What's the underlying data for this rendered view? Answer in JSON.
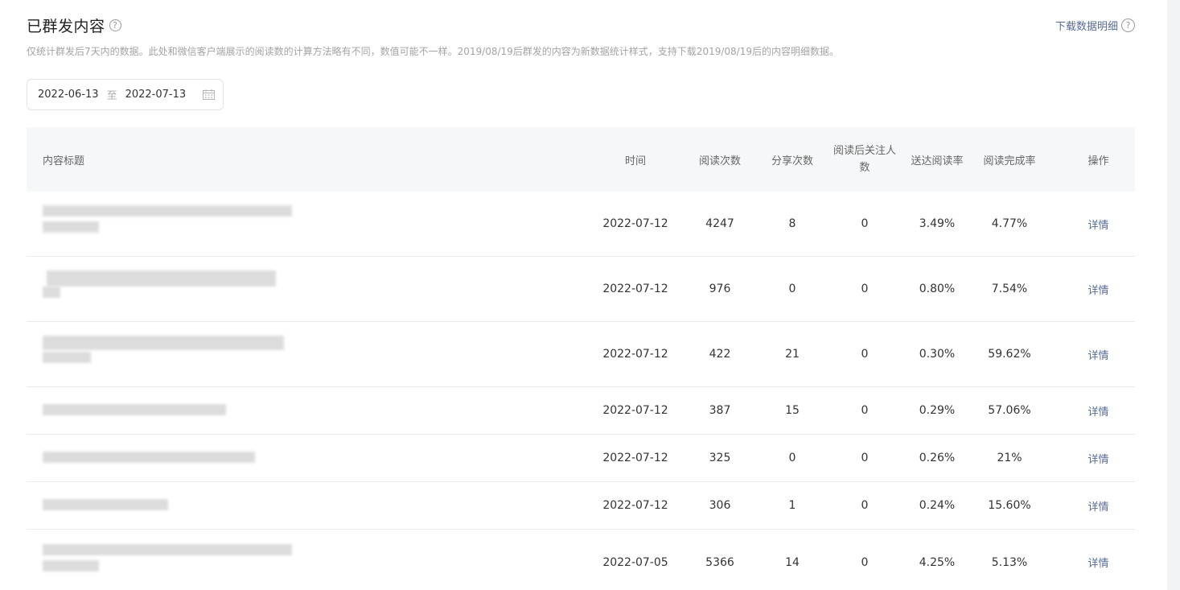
{
  "header": {
    "title": "已群发内容",
    "help_glyph": "?",
    "download_label": "下载数据明细",
    "description": "仅统计群发后7天内的数据。此处和微信客户端展示的阅读数的计算方法略有不同，数值可能不一样。2019/08/19后群发的内容为新数据统计样式，支持下载2019/08/19后的内容明细数据。"
  },
  "date_range": {
    "start": "2022-06-13",
    "separator": "至",
    "end": "2022-07-13"
  },
  "table": {
    "columns": {
      "title": "内容标题",
      "time": "时间",
      "reads": "阅读次数",
      "shares": "分享次数",
      "follows": "阅读后关注人数",
      "arrive_rate": "送达阅读率",
      "complete_rate": "阅读完成率",
      "action": "操作"
    },
    "rows": [
      {
        "time": "2022-07-12",
        "reads": "4247",
        "shares": "8",
        "follows": "0",
        "arrive_rate": "3.49%",
        "complete_rate": "4.77%",
        "action": "详情"
      },
      {
        "time": "2022-07-12",
        "reads": "976",
        "shares": "0",
        "follows": "0",
        "arrive_rate": "0.80%",
        "complete_rate": "7.54%",
        "action": "详情"
      },
      {
        "time": "2022-07-12",
        "reads": "422",
        "shares": "21",
        "follows": "0",
        "arrive_rate": "0.30%",
        "complete_rate": "59.62%",
        "action": "详情"
      },
      {
        "time": "2022-07-12",
        "reads": "387",
        "shares": "15",
        "follows": "0",
        "arrive_rate": "0.29%",
        "complete_rate": "57.06%",
        "action": "详情"
      },
      {
        "time": "2022-07-12",
        "reads": "325",
        "shares": "0",
        "follows": "0",
        "arrive_rate": "0.26%",
        "complete_rate": "21%",
        "action": "详情"
      },
      {
        "time": "2022-07-12",
        "reads": "306",
        "shares": "1",
        "follows": "0",
        "arrive_rate": "0.24%",
        "complete_rate": "15.60%",
        "action": "详情"
      },
      {
        "time": "2022-07-05",
        "reads": "5366",
        "shares": "14",
        "follows": "0",
        "arrive_rate": "4.25%",
        "complete_rate": "5.13%",
        "action": "详情"
      }
    ]
  },
  "icons": {
    "help": "help-circle-icon",
    "calendar": "calendar-icon"
  },
  "colors": {
    "link": "#576b95",
    "header_bg": "#f6f7f8",
    "muted_text": "#a3a3a3"
  }
}
